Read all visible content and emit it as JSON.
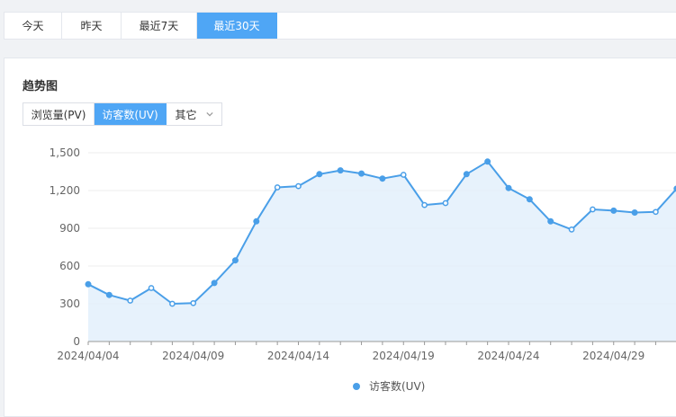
{
  "tabs": [
    {
      "label": "今天",
      "active": false
    },
    {
      "label": "昨天",
      "active": false
    },
    {
      "label": "最近7天",
      "active": false
    },
    {
      "label": "最近30天",
      "active": true
    }
  ],
  "panel": {
    "title": "趋势图",
    "metrics": [
      {
        "label": "浏览量(PV)",
        "active": false
      },
      {
        "label": "访客数(UV)",
        "active": true
      },
      {
        "label": "其它",
        "active": false,
        "icon": "chevron-down-icon"
      }
    ]
  },
  "colors": {
    "accent": "#4fa6f5",
    "line": "#4a9fe8",
    "area": "#e3f0fc"
  },
  "chart_data": {
    "type": "area",
    "x": [
      "2024/04/04",
      "2024/04/05",
      "2024/04/06",
      "2024/04/07",
      "2024/04/08",
      "2024/04/09",
      "2024/04/10",
      "2024/04/11",
      "2024/04/12",
      "2024/04/13",
      "2024/04/14",
      "2024/04/15",
      "2024/04/16",
      "2024/04/17",
      "2024/04/18",
      "2024/04/19",
      "2024/04/20",
      "2024/04/21",
      "2024/04/22",
      "2024/04/23",
      "2024/04/24",
      "2024/04/25",
      "2024/04/26",
      "2024/04/27",
      "2024/04/28",
      "2024/04/29",
      "2024/04/30",
      "2024/05/01",
      "2024/05/02"
    ],
    "series": [
      {
        "name": "访客数(UV)",
        "values": [
          455,
          370,
          325,
          425,
          300,
          305,
          465,
          645,
          955,
          1225,
          1235,
          1330,
          1360,
          1335,
          1295,
          1325,
          1085,
          1100,
          1330,
          1430,
          1220,
          1130,
          955,
          890,
          1050,
          1040,
          1025,
          1030,
          1215
        ],
        "hollow_markers": [
          false,
          false,
          true,
          true,
          true,
          true,
          false,
          false,
          false,
          true,
          true,
          false,
          false,
          false,
          false,
          true,
          true,
          true,
          false,
          false,
          false,
          false,
          false,
          true,
          true,
          false,
          false,
          true,
          false
        ]
      }
    ],
    "x_tick_labels": [
      "2024/04/04",
      "2024/04/09",
      "2024/04/14",
      "2024/04/19",
      "2024/04/24",
      "2024/04/29"
    ],
    "y_ticks": [
      "0",
      "300",
      "600",
      "900",
      "1,200",
      "1,500"
    ],
    "ylim": [
      0,
      1500
    ],
    "grid": true,
    "legend": "bottom-center"
  }
}
